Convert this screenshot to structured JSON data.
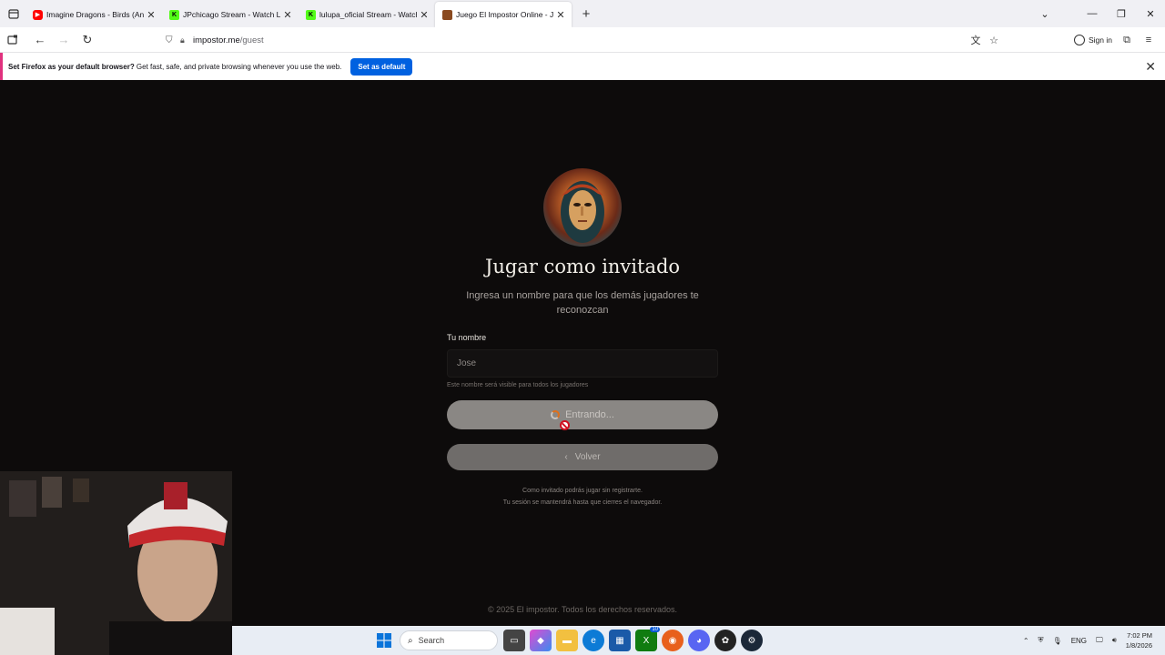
{
  "browser": {
    "tabs": [
      {
        "title": "Imagine Dragons - Birds (Anima",
        "favicon": "youtube-icon",
        "color": "#ff0000",
        "active": false
      },
      {
        "title": "JPchicago Stream - Watch Live o",
        "favicon": "kick-icon",
        "color": "#53fc18",
        "active": false
      },
      {
        "title": "lulupa_oficial Stream - Watch Li",
        "favicon": "kick-icon",
        "color": "#53fc18",
        "active": false
      },
      {
        "title": "Juego El Impostor Online - Juga",
        "favicon": "impostor-icon",
        "color": "#8a4a20",
        "active": true
      }
    ],
    "url_host": "impostor.me",
    "url_path": "/guest",
    "sign_in": "Sign in"
  },
  "notification": {
    "bold": "Set Firefox as your default browser?",
    "text": " Get fast, safe, and private browsing whenever you use the web.",
    "button": "Set as default"
  },
  "page": {
    "title": "Jugar como invitado",
    "subtitle": "Ingresa un nombre para que los demás jugadores te reconozcan",
    "name_label": "Tu nombre",
    "name_value": "Jose",
    "name_hint": "Este nombre será visible para todos los jugadores",
    "enter_button": "Entrando...",
    "back_button": "Volver",
    "guest_note_1": "Como invitado podrás jugar sin registrarte.",
    "guest_note_2": "Tu sesión se mantendrá hasta que cierres el navegador.",
    "footer": "© 2025 El impostor. Todos los derechos reservados."
  },
  "taskbar": {
    "search": "Search",
    "language": "ENG",
    "time": "7:02 PM",
    "date": "1/8/2026",
    "badge_count": "10"
  }
}
